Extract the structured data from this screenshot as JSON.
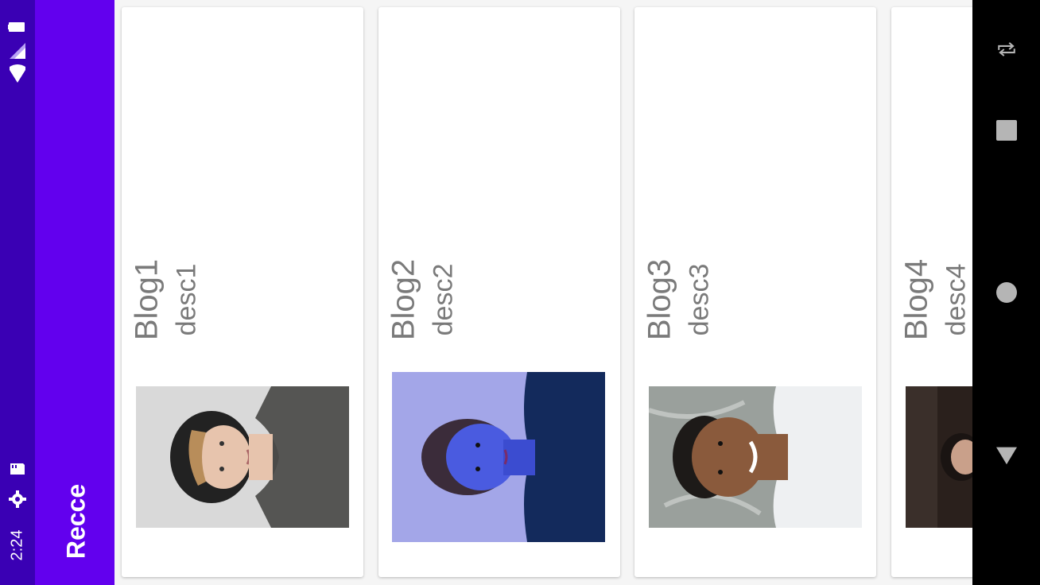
{
  "status_bar": {
    "time": "2:24",
    "icons": [
      "battery-icon",
      "signal-icon",
      "wifi-icon",
      "sd-card-icon",
      "settings-gear-icon"
    ]
  },
  "app_bar": {
    "title": "Recce"
  },
  "blogs": [
    {
      "title": "Blog1",
      "desc": "desc1"
    },
    {
      "title": "Blog2",
      "desc": "desc2"
    },
    {
      "title": "Blog3",
      "desc": "desc3"
    },
    {
      "title": "Blog4",
      "desc": "desc4"
    }
  ],
  "nav_bar": {
    "buttons": [
      "rotate-icon",
      "recents-icon",
      "home-icon",
      "back-icon"
    ]
  },
  "colors": {
    "status_bar": "#3a00b4",
    "app_bar": "#6200ee",
    "text_secondary": "#7a7a7a"
  }
}
